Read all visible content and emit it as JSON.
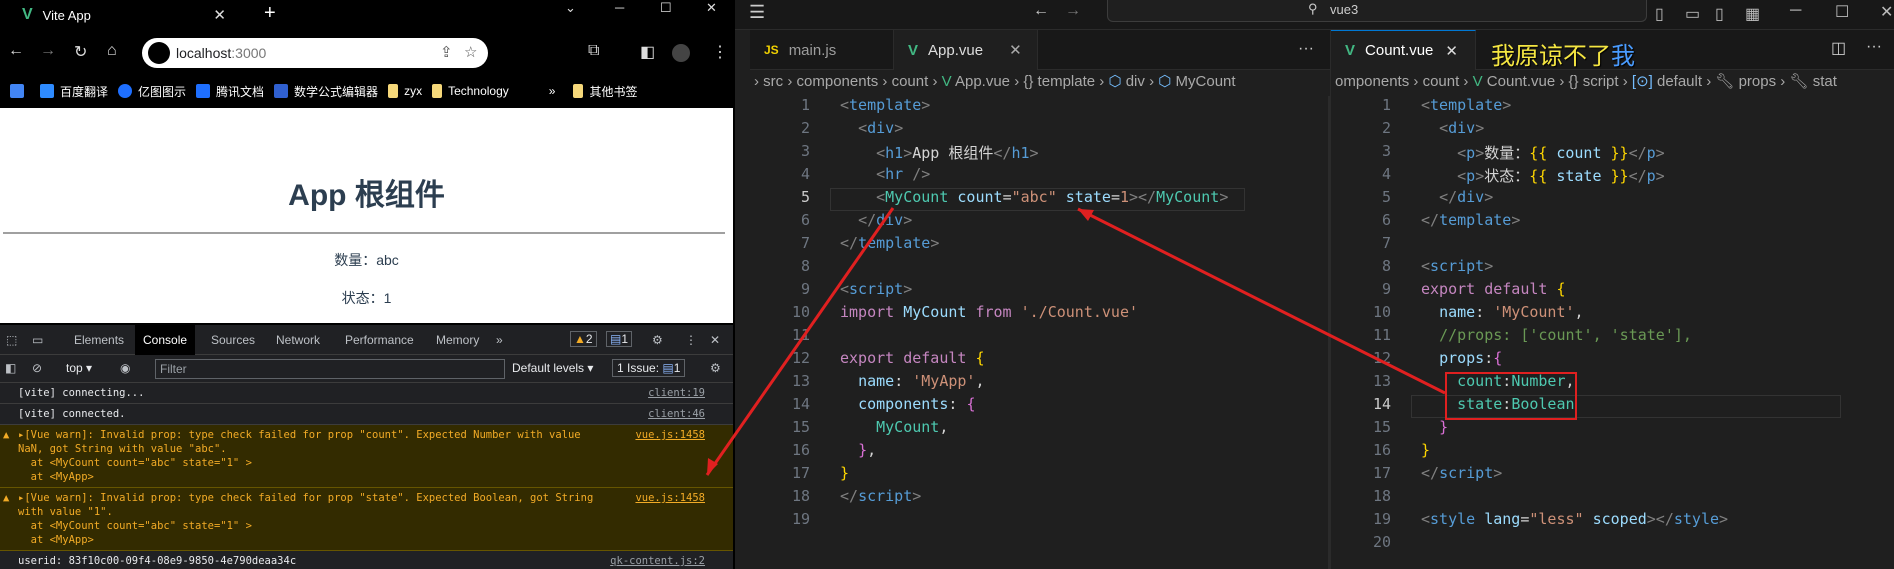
{
  "browser": {
    "tab_title": "Vite App",
    "url_host": "localhost",
    "url_port": ":3000",
    "bookmarks": [
      {
        "label": "",
        "icon": "google-translate-icon",
        "color": "#4285f4"
      },
      {
        "label": "百度翻译",
        "icon": "baidu-translate-icon",
        "color": "#2e8bff"
      },
      {
        "label": "亿图图示",
        "icon": "edraw-icon",
        "color": "#1e6fff"
      },
      {
        "label": "腾讯文档",
        "icon": "tencent-docs-icon",
        "color": "#1e6fff"
      },
      {
        "label": "数学公式编辑器",
        "icon": "math-editor-icon",
        "color": "#3060d0"
      },
      {
        "label": "zyx",
        "icon": "folder-icon",
        "color": "#f6d87a"
      },
      {
        "label": "Technology",
        "icon": "folder-icon",
        "color": "#f6d87a"
      }
    ],
    "overflow_label": "»",
    "other_bookmarks": "其他书签",
    "page": {
      "heading": "App 根组件",
      "count_line": "数量：abc",
      "state_line": "状态：1"
    }
  },
  "devtools": {
    "tabs": [
      "Elements",
      "Console",
      "Sources",
      "Network",
      "Performance",
      "Memory"
    ],
    "active_tab": "Console",
    "more_tabs": "»",
    "warning_count": "2",
    "message_count": "1",
    "context": "top",
    "filter_placeholder": "Filter",
    "levels": "Default levels",
    "issues": "1 Issue:",
    "issues_count": "1",
    "messages": [
      {
        "type": "log",
        "text": "[vite] connecting...",
        "source": "client:19"
      },
      {
        "type": "log",
        "text": "[vite] connected.",
        "source": "client:46"
      },
      {
        "type": "warn",
        "text": "▸[Vue warn]: Invalid prop: type check failed for prop \"count\". Expected Number with value\nNaN, got String with value \"abc\".\n  at <MyCount count=\"abc\" state=\"1\" >\n  at <MyApp>",
        "source": "vue.js:1458"
      },
      {
        "type": "warn",
        "text": "▸[Vue warn]: Invalid prop: type check failed for prop \"state\". Expected Boolean, got String\nwith value \"1\".\n  at <MyCount count=\"abc\" state=\"1\" >\n  at <MyApp>",
        "source": "vue.js:1458"
      },
      {
        "type": "log",
        "text": "userid: 83f10c00-09f4-08e9-9850-4e790deaa34c",
        "source": "qk-content.js:2"
      }
    ]
  },
  "vscode": {
    "search_text": "vue3",
    "overlay_text_yellow": "我原谅不了",
    "overlay_text_blue": "我",
    "left": {
      "tabs": [
        {
          "label": "main.js",
          "icon": "JS"
        },
        {
          "label": "App.vue",
          "icon": "vue"
        }
      ],
      "breadcrumb": [
        "src",
        "components",
        "count",
        "App.vue",
        "{} template",
        "div",
        "MyCount"
      ],
      "current_line": 5
    },
    "right": {
      "tabs": [
        {
          "label": "Count.vue",
          "icon": "vue"
        }
      ],
      "breadcrumb": [
        "omponents",
        "count",
        "Count.vue",
        "{} script",
        "default",
        "props",
        "stat"
      ],
      "current_line": 14
    }
  }
}
